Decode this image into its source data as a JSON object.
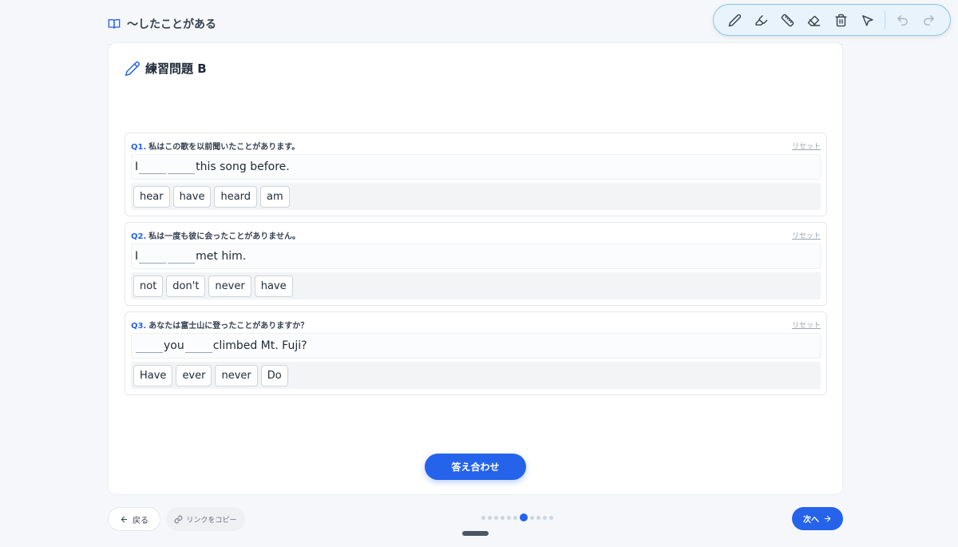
{
  "header": {
    "title": "〜したことがある"
  },
  "card": {
    "title": "練習問題 B"
  },
  "questions": [
    {
      "num": "Q1.",
      "prompt": "私はこの歌を以前聞いたことがあります。",
      "reset": "リセット",
      "sentence": [
        "I",
        "",
        "",
        "this song before."
      ],
      "options": [
        "hear",
        "have",
        "heard",
        "am"
      ]
    },
    {
      "num": "Q2.",
      "prompt": "私は一度も彼に会ったことがありません。",
      "reset": "リセット",
      "sentence": [
        "I",
        "",
        "",
        "met him."
      ],
      "options": [
        "not",
        "don't",
        "never",
        "have"
      ]
    },
    {
      "num": "Q3.",
      "prompt": "あなたは富士山に登ったことがありますか？",
      "reset": "リセット",
      "sentence": [
        "",
        "you",
        "",
        "climbed Mt. Fuji?"
      ],
      "options": [
        "Have",
        "ever",
        "never",
        "Do"
      ]
    }
  ],
  "check_button": "答え合わせ",
  "footer": {
    "back_label": "戻る",
    "copy_label": "リンクをコピー",
    "next_label": "次へ",
    "page_count": 11,
    "current_page": 7
  }
}
